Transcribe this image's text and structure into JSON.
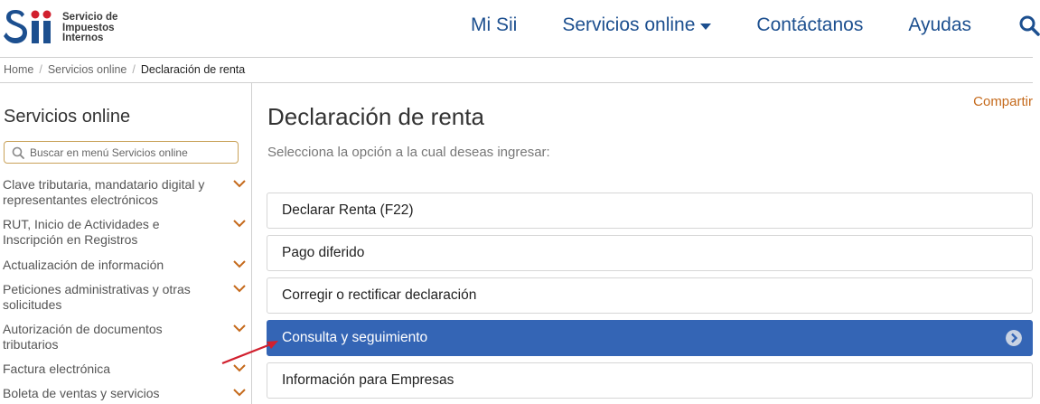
{
  "header": {
    "logo_text_lines": [
      "Servicio de",
      "Impuestos",
      "Internos"
    ],
    "logo_mark_letters": "Sii",
    "brand_color": "#1c4f8f",
    "accent_red": "#d1202e",
    "nav": [
      {
        "label": "Mi Sii"
      },
      {
        "label": "Servicios online",
        "has_dropdown": true
      },
      {
        "label": "Contáctanos"
      },
      {
        "label": "Ayudas"
      }
    ],
    "search_icon": "search-icon"
  },
  "breadcrumb": {
    "items": [
      "Home",
      "Servicios online"
    ],
    "current": "Declaración de renta",
    "separator": "/"
  },
  "sidebar": {
    "title": "Servicios online",
    "search_placeholder": "Buscar en menú Servicios online",
    "items": [
      {
        "label": "Clave tributaria, mandatario digital y representantes electrónicos"
      },
      {
        "label": "RUT, Inicio de Actividades e Inscripción en Registros"
      },
      {
        "label": "Actualización de información"
      },
      {
        "label": "Peticiones administrativas y otras solicitudes"
      },
      {
        "label": "Autorización de documentos tributarios"
      },
      {
        "label": "Factura electrónica"
      },
      {
        "label": "Boleta de ventas y servicios"
      }
    ],
    "chevron_color": "#c56a1c"
  },
  "main": {
    "share_label": "Compartir",
    "title": "Declaración de renta",
    "subtitle": "Selecciona la opción a la cual deseas ingresar:",
    "options": [
      {
        "label": "Declarar Renta (F22)",
        "active": false
      },
      {
        "label": "Pago diferido",
        "active": false
      },
      {
        "label": "Corregir o rectificar declaración",
        "active": false
      },
      {
        "label": "Consulta y seguimiento",
        "active": true
      },
      {
        "label": "Información para Empresas",
        "active": false
      }
    ],
    "active_color": "#3465b5"
  }
}
